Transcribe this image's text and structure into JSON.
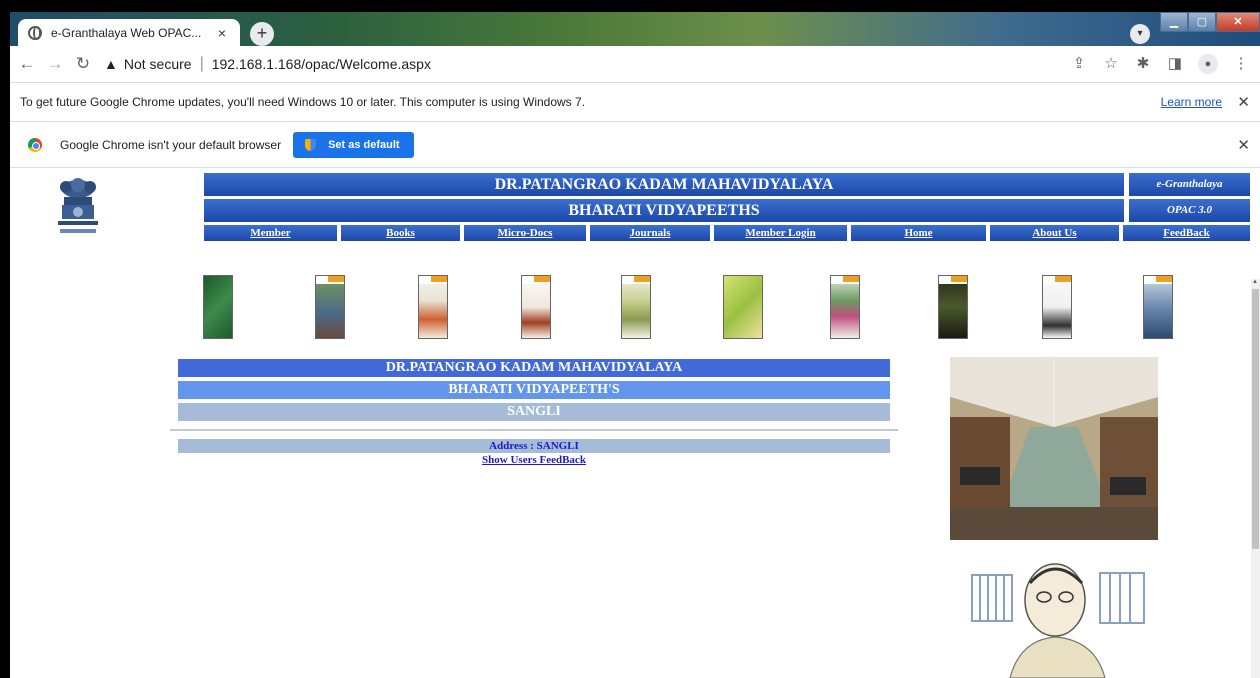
{
  "browser": {
    "tab_title": "e-Granthalaya Web OPAC...",
    "tab_close": "×",
    "new_tab": "+",
    "not_secure": "Not secure",
    "url": "192.168.1.168/opac/Welcome.aspx"
  },
  "update_bar": {
    "message": "To get future Google Chrome updates, you'll need Windows 10 or later. This computer is using Windows 7.",
    "learn_more": "Learn more"
  },
  "default_bar": {
    "message": "Google Chrome isn't your default browser",
    "button": "Set as default"
  },
  "header": {
    "title": "DR.PATANGRAO KADAM MAHAVIDYALAYA",
    "subtitle": "BHARATI VIDYAPEETHS",
    "side_top": "e-Granthalaya",
    "side_bottom": "OPAC 3.0"
  },
  "menu": [
    "Member",
    "Books",
    "Micro-Docs",
    "Journals",
    "Member Login",
    "Home",
    "About Us",
    "FeedBack"
  ],
  "main": {
    "line1": "DR.PATANGRAO KADAM MAHAVIDYALAYA",
    "line2": "BHARATI VIDYAPEETH'S",
    "line3": "SANGLI",
    "address": "Address : SANGLI",
    "feedback_link": "Show Users FeedBack"
  },
  "colors": {
    "header_blue": "#1c47a8",
    "bar1": "#4169d8",
    "bar2": "#6495ed",
    "bar3": "#a6bbd8",
    "link_blue": "#1a1acc"
  },
  "book_covers": [
    {
      "name": "book-cover-botany-in-a-day"
    },
    {
      "name": "book-cover-2"
    },
    {
      "name": "book-cover-3"
    },
    {
      "name": "book-cover-4"
    },
    {
      "name": "book-cover-5"
    },
    {
      "name": "book-cover-essential-botany"
    },
    {
      "name": "book-cover-7"
    },
    {
      "name": "book-cover-8"
    },
    {
      "name": "book-cover-9"
    },
    {
      "name": "book-cover-10"
    }
  ]
}
